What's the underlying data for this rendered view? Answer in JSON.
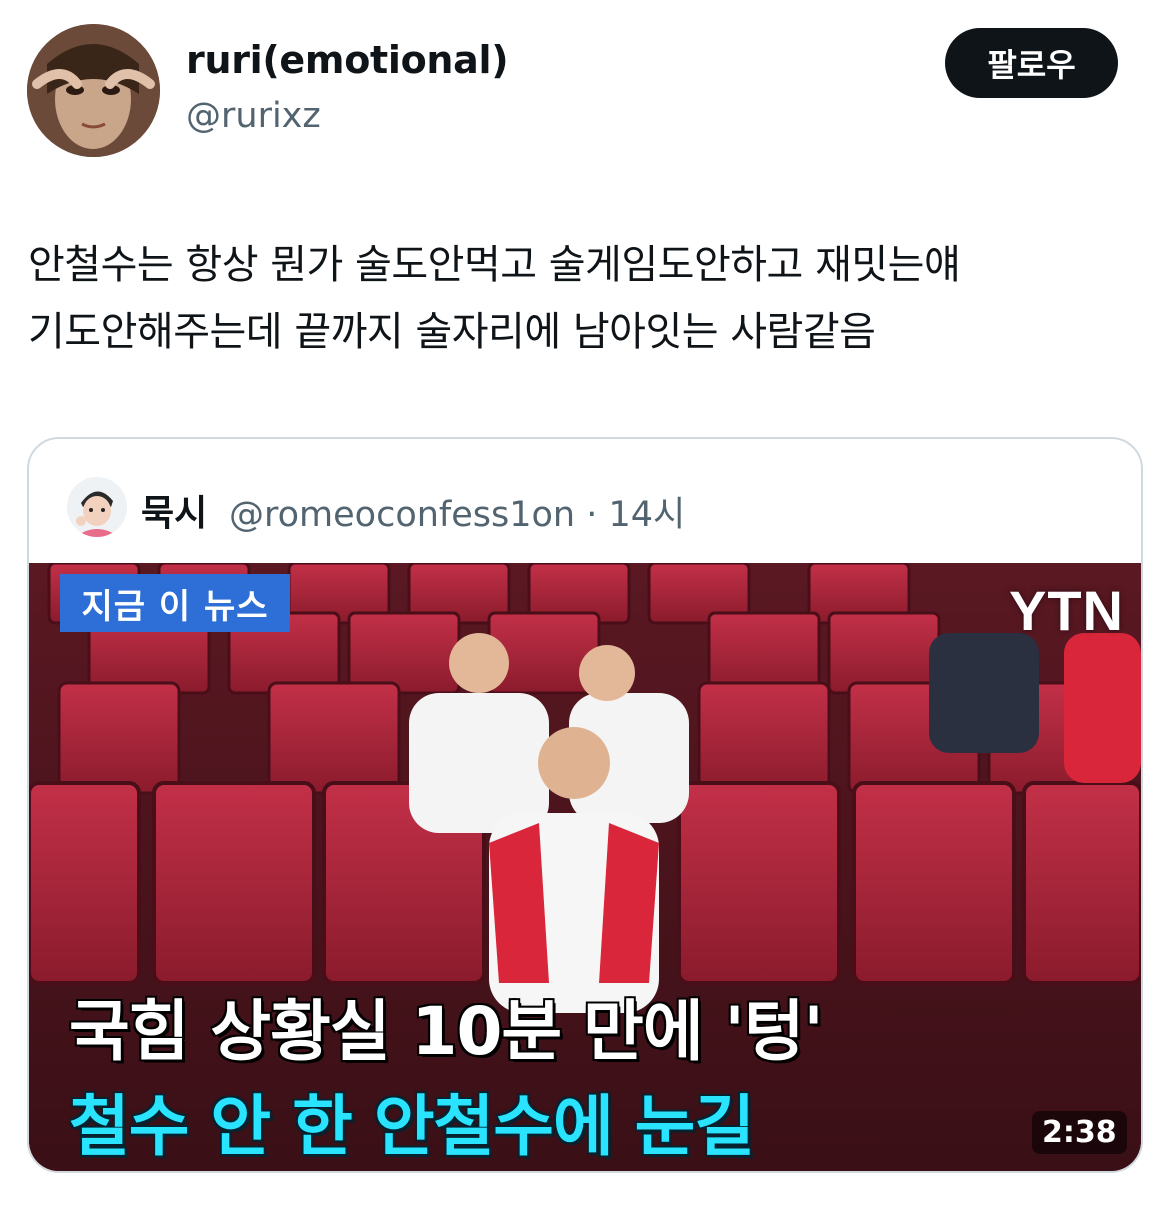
{
  "author": {
    "name": "ruri(emotional)",
    "handle": "@rurixz",
    "avatar_icon": "profile-photo"
  },
  "follow_label": "팔로우",
  "tweet": {
    "line1": "안철수는 항상 뭔가 술도안먹고 술게임도안하고 재밋는얘",
    "line2": "기도안해주는데 끝까지 술자리에 남아잇는 사람같음"
  },
  "quoted": {
    "name": "묵시",
    "handle_time": "@romeoconfess1on · 14시",
    "media": {
      "badge": "지금 이 뉴스",
      "logo": "YTN",
      "headline1": "국힘 상황실 10분 만에 '텅'",
      "headline2": "철수 안 한 안철수에 눈길",
      "duration": "2:38"
    }
  },
  "colors": {
    "follow_bg": "#0f1419",
    "badge_bg": "#2d6fd6",
    "headline2": "#29e3ff",
    "seat_red": "#b5283c"
  }
}
